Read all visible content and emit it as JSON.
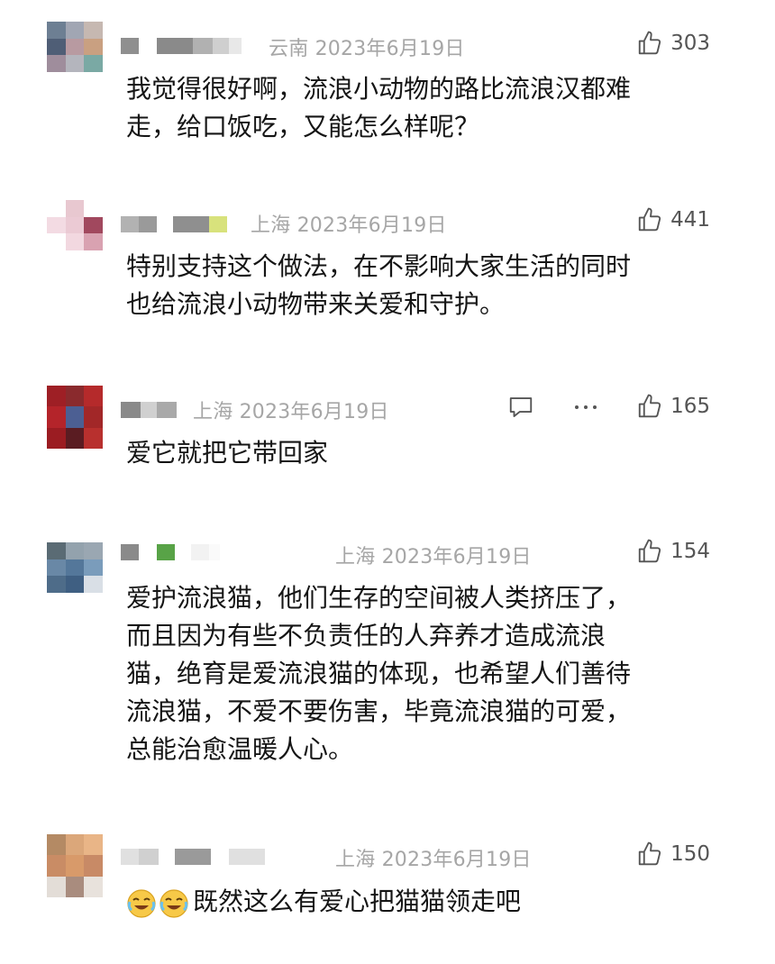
{
  "comments": [
    {
      "location": "云南",
      "date": "2023年6月19日",
      "likes": "303",
      "text": "我觉得很好啊，流浪小动物的路比流浪汉都难\n走，给口饭吃，又能怎么样呢？"
    },
    {
      "location": "上海",
      "date": "2023年6月19日",
      "likes": "441",
      "text": "特别支持这个做法，在不影响大家生活的同时\n也给流浪小动物带来关爱和守护。"
    },
    {
      "location": "上海",
      "date": "2023年6月19日",
      "likes": "165",
      "text": "爱它就把它带回家"
    },
    {
      "location": "上海",
      "date": "2023年6月19日",
      "likes": "154",
      "text": "爱护流浪猫，他们生存的空间被人类挤压了，\n而且因为有些不负责任的人弃养才造成流浪\n猫，绝育是爱流浪猫的体现，也希望人们善待\n流浪猫，不爱不要伤害，毕竟流浪猫的可爱，\n总能治愈温暖人心。"
    },
    {
      "location": "上海",
      "date": "2023年6月19日",
      "likes": "150",
      "text": "既然这么有爱心把猫猫领走吧"
    }
  ],
  "icons": {
    "like": "thumbs-up-icon",
    "reply": "comment-bubble-icon",
    "more": "more-dots-icon",
    "emoji": "crying-laughing-emoji-icon"
  }
}
